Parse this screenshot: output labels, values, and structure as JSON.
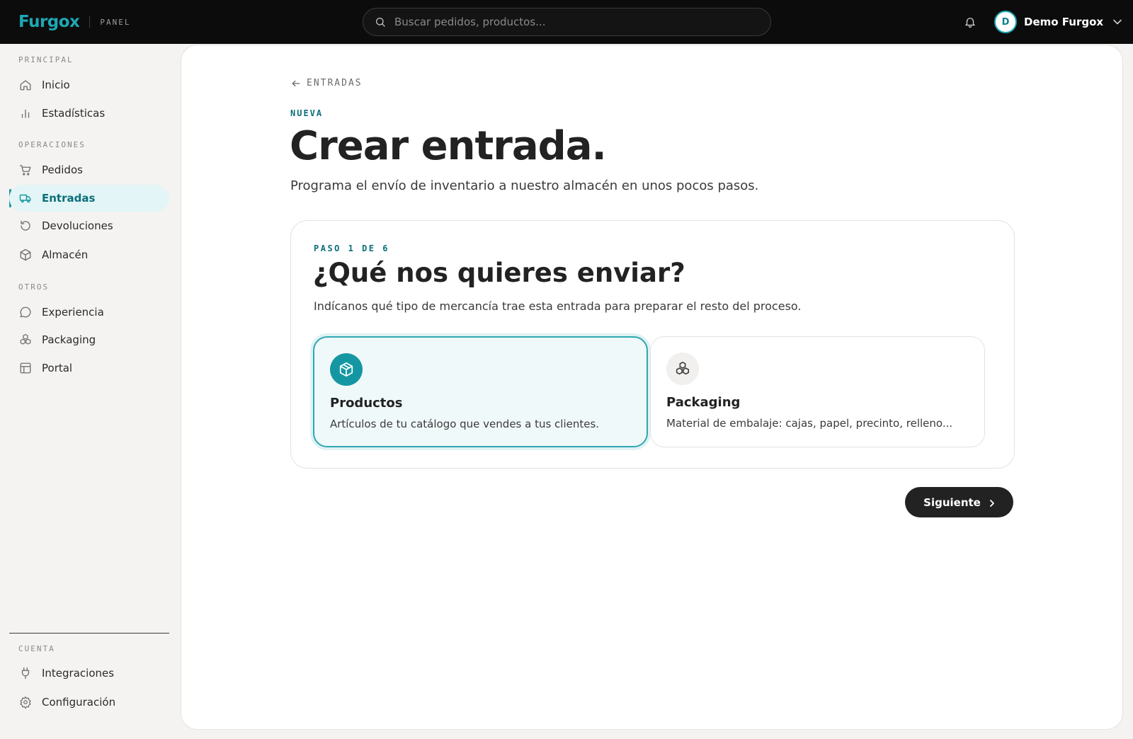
{
  "app": {
    "logo": "Furgox",
    "tag": "PANEL"
  },
  "search": {
    "placeholder": "Buscar pedidos, productos..."
  },
  "user": {
    "initial": "D",
    "name": "Demo Furgox"
  },
  "sidebar": {
    "sections": [
      {
        "label": "PRINCIPAL"
      },
      {
        "label": "OPERACIONES"
      },
      {
        "label": "OTROS"
      },
      {
        "label": "CUENTA"
      }
    ],
    "items": [
      {
        "label": "Inicio",
        "icon": "home-icon"
      },
      {
        "label": "Estadísticas",
        "icon": "bar-chart-icon"
      },
      {
        "label": "Pedidos",
        "icon": "cart-icon"
      },
      {
        "label": "Entradas",
        "icon": "truck-icon",
        "active": true
      },
      {
        "label": "Devoluciones",
        "icon": "return-icon"
      },
      {
        "label": "Almacén",
        "icon": "box-icon"
      },
      {
        "label": "Experiencia",
        "icon": "chat-icon"
      },
      {
        "label": "Packaging",
        "icon": "boxes-icon"
      },
      {
        "label": "Portal",
        "icon": "layout-icon"
      },
      {
        "label": "Integraciones",
        "icon": "plug-icon"
      },
      {
        "label": "Configuración",
        "icon": "gear-icon"
      }
    ]
  },
  "main": {
    "back_label": "ENTRADAS",
    "eyebrow": "NUEVA",
    "title": "Crear entrada.",
    "subtitle": "Programa el envío de inventario a nuestro almacén en unos pocos pasos.",
    "step": {
      "eyebrow": "PASO 1 DE 6",
      "title": "¿Qué nos quieres enviar?",
      "description": "Indícanos qué tipo de mercancía trae esta entrada para preparar el resto del proceso.",
      "options": [
        {
          "title": "Productos",
          "description": "Artículos de tu catálogo que vendes a tus clientes.",
          "icon": "package-icon",
          "selected": true
        },
        {
          "title": "Packaging",
          "description": "Material de embalaje: cajas, papel, precinto, relleno...",
          "icon": "boxes-icon",
          "selected": false
        }
      ]
    },
    "next_label": "Siguiente"
  },
  "colors": {
    "accent": "#1a97a3",
    "accent_dark": "#0c6f7a",
    "topbar": "#0c0c0c",
    "button": "#222222"
  }
}
